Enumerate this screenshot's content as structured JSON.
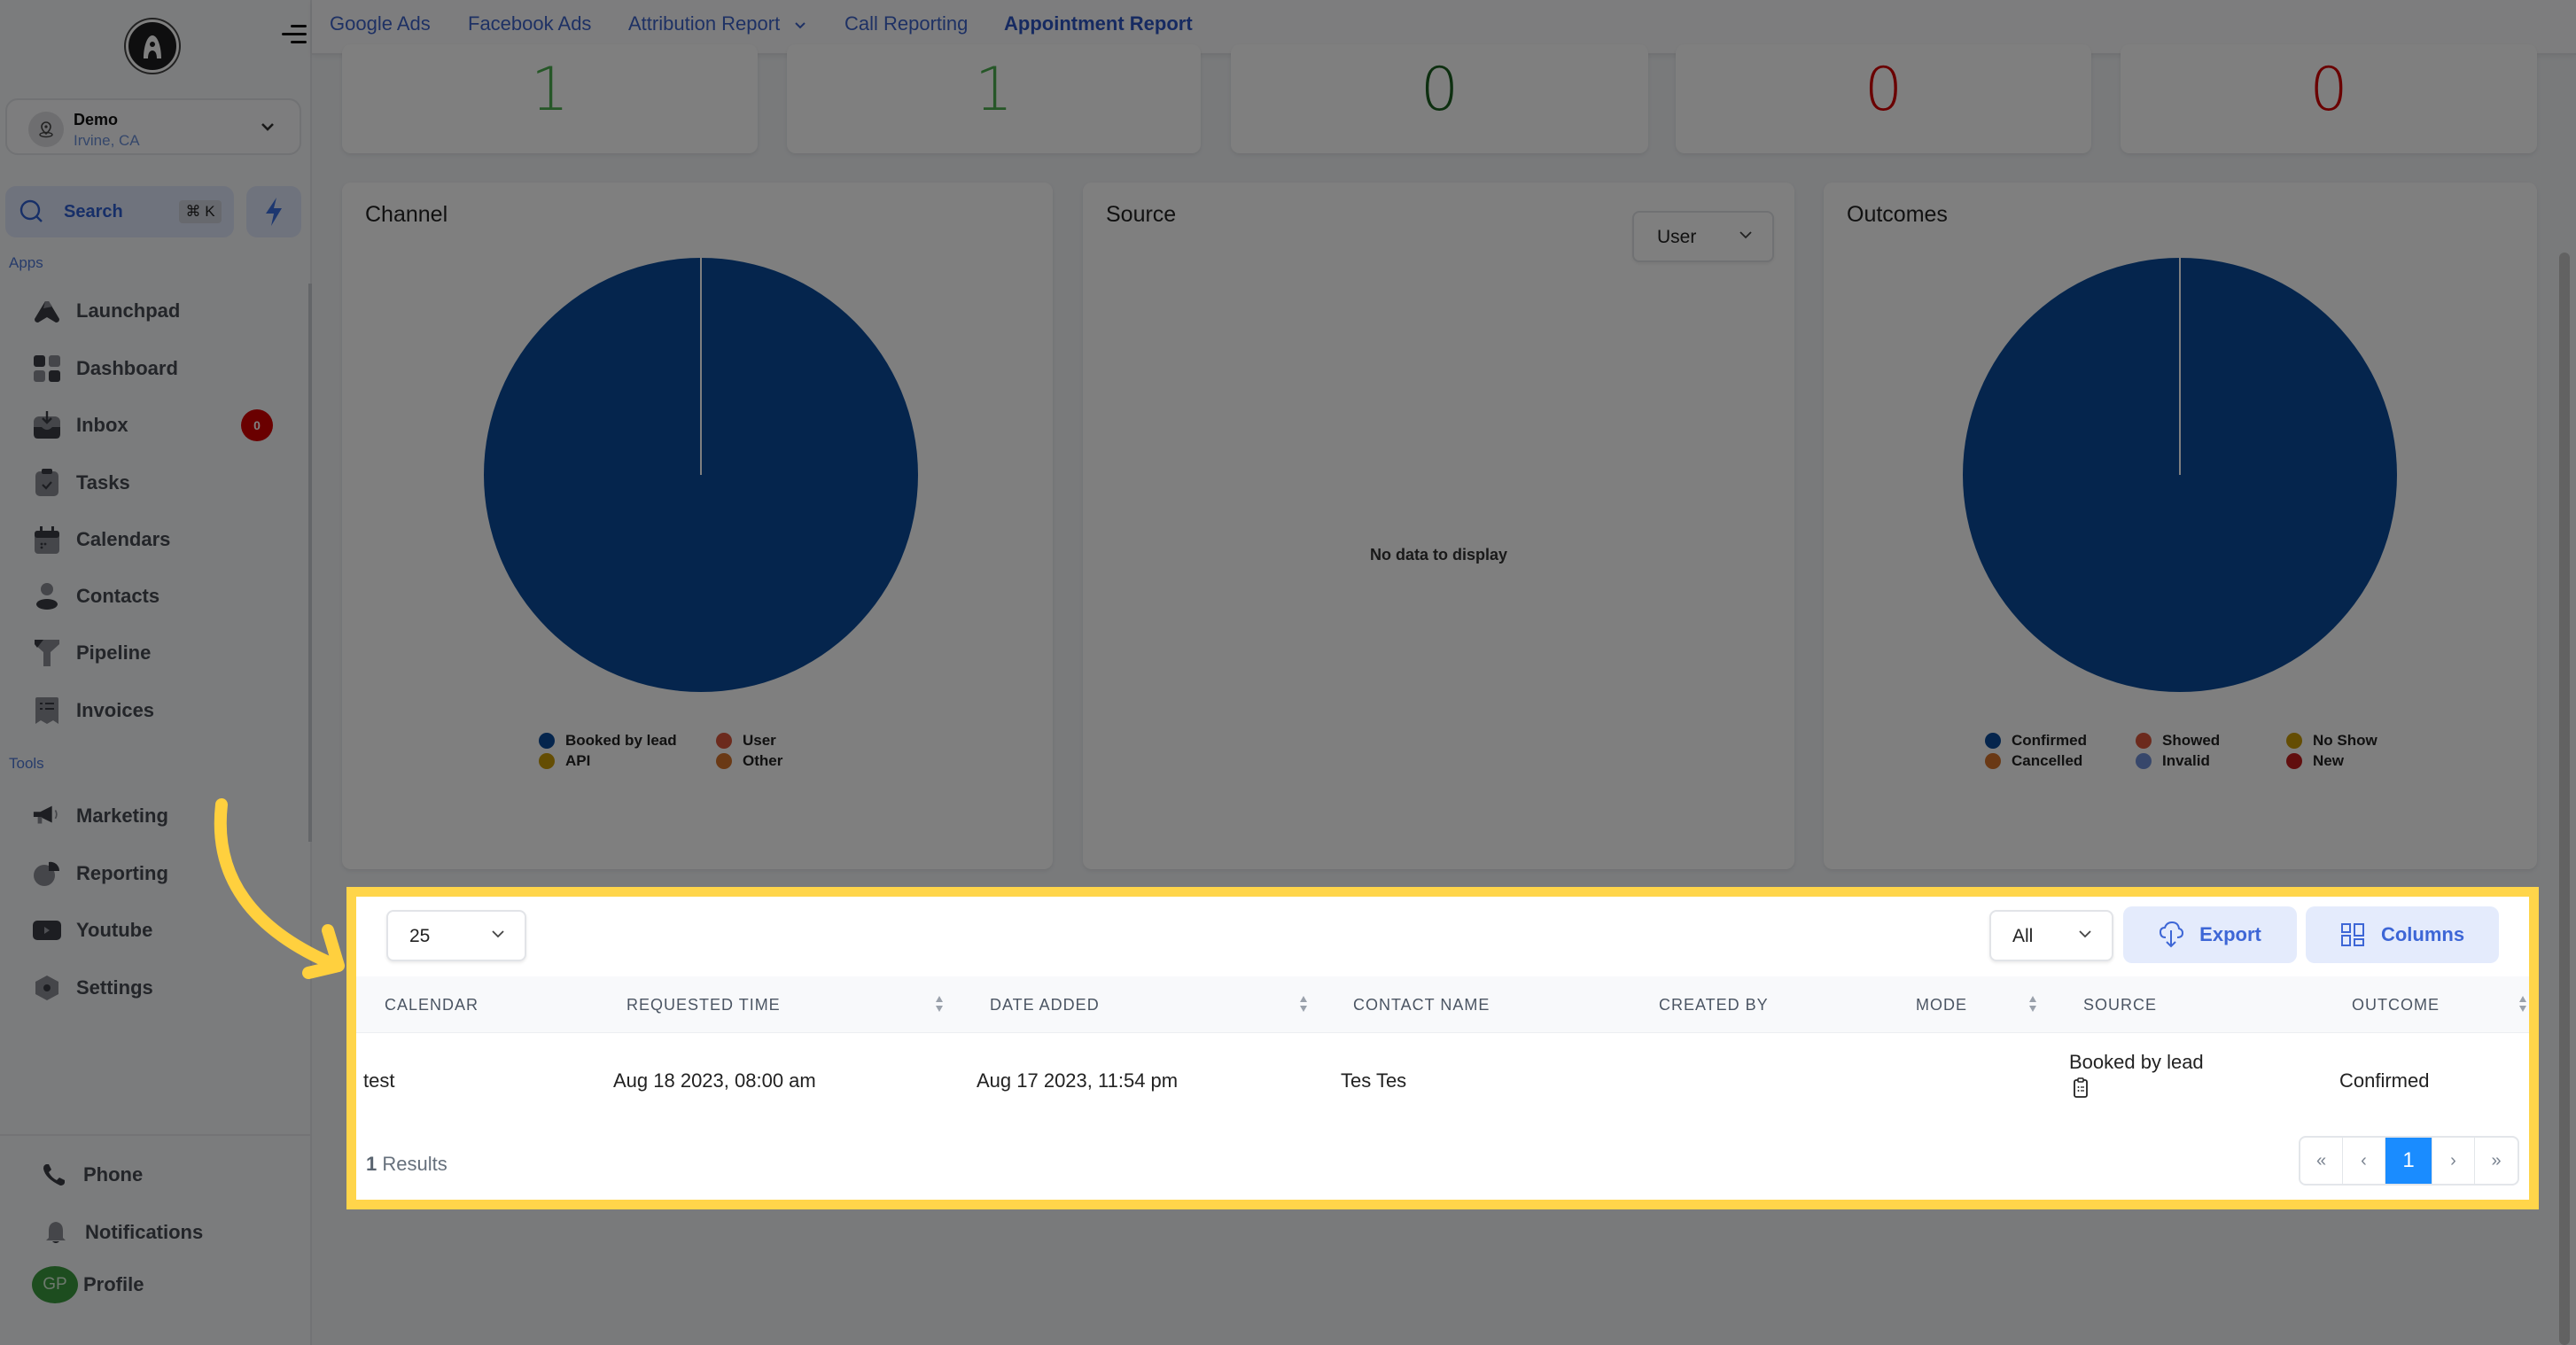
{
  "sidebar": {
    "account": {
      "name": "Demo",
      "location": "Irvine, CA"
    },
    "search": {
      "label": "Search",
      "shortcut": "⌘ K"
    },
    "apps_label": "Apps",
    "tools_label": "Tools",
    "apps": [
      {
        "label": "Launchpad",
        "icon": "rocket-icon"
      },
      {
        "label": "Dashboard",
        "icon": "grid-icon"
      },
      {
        "label": "Inbox",
        "icon": "inbox-icon",
        "badge": "0"
      },
      {
        "label": "Tasks",
        "icon": "clipboard-check-icon"
      },
      {
        "label": "Calendars",
        "icon": "calendar-icon"
      },
      {
        "label": "Contacts",
        "icon": "person-icon"
      },
      {
        "label": "Pipeline",
        "icon": "funnel-icon"
      },
      {
        "label": "Invoices",
        "icon": "invoice-icon"
      }
    ],
    "tools": [
      {
        "label": "Marketing",
        "icon": "megaphone-icon"
      },
      {
        "label": "Reporting",
        "icon": "pie-chart-icon"
      },
      {
        "label": "Youtube",
        "icon": "play-icon"
      },
      {
        "label": "Settings",
        "icon": "gear-icon"
      }
    ],
    "bottom": {
      "phone": "Phone",
      "notifications": "Notifications",
      "profile": "Profile",
      "profile_initials": "GP"
    }
  },
  "tabs": [
    {
      "label": "Google Ads",
      "active": false
    },
    {
      "label": "Facebook Ads",
      "active": false
    },
    {
      "label": "Attribution Report",
      "active": false,
      "dropdown": true
    },
    {
      "label": "Call Reporting",
      "active": false
    },
    {
      "label": "Appointment Report",
      "active": true
    }
  ],
  "stats": [
    {
      "value": "1",
      "color": "#4caf50"
    },
    {
      "value": "1",
      "color": "#4caf50"
    },
    {
      "value": "0",
      "color": "#1b5e20"
    },
    {
      "value": "0",
      "color": "#d50000"
    },
    {
      "value": "0",
      "color": "#d50000"
    }
  ],
  "chart_data": [
    {
      "type": "pie",
      "title": "Channel",
      "categories": [
        "Booked by lead",
        "API",
        "User",
        "Other"
      ],
      "values": [
        1,
        0,
        0,
        0
      ],
      "colors": [
        "#0a4a9a",
        "#c99a06",
        "#d9543a",
        "#d4732a"
      ],
      "legend": "bottom"
    },
    {
      "type": "pie",
      "title": "Source",
      "filter": "User",
      "categories": [],
      "values": [],
      "empty_message": "No data to display"
    },
    {
      "type": "pie",
      "title": "Outcomes",
      "categories": [
        "Confirmed",
        "Cancelled",
        "Showed",
        "Invalid",
        "No Show",
        "New"
      ],
      "values": [
        1,
        0,
        0,
        0,
        0,
        0
      ],
      "colors": [
        "#0a4a9a",
        "#d4732a",
        "#d9543a",
        "#6f8fd6",
        "#c99a06",
        "#c21d1d"
      ],
      "legend": "bottom"
    }
  ],
  "table": {
    "page_size": "25",
    "filter": "All",
    "export_label": "Export",
    "columns_label": "Columns",
    "headers": [
      "CALENDAR",
      "REQUESTED TIME",
      "DATE ADDED",
      "CONTACT NAME",
      "CREATED BY",
      "MODE",
      "SOURCE",
      "OUTCOME"
    ],
    "rows": [
      {
        "calendar": "test",
        "requested_time": "Aug 18 2023, 08:00 am",
        "date_added": "Aug 17 2023, 11:54 pm",
        "contact_name": "Tes Tes",
        "created_by": "",
        "mode": "",
        "source": "Booked by lead",
        "outcome": "Confirmed"
      }
    ],
    "results_count": "1",
    "results_label": "Results",
    "pagination": {
      "first": "«",
      "prev": "‹",
      "current": "1",
      "next": "›",
      "last": "»"
    }
  }
}
